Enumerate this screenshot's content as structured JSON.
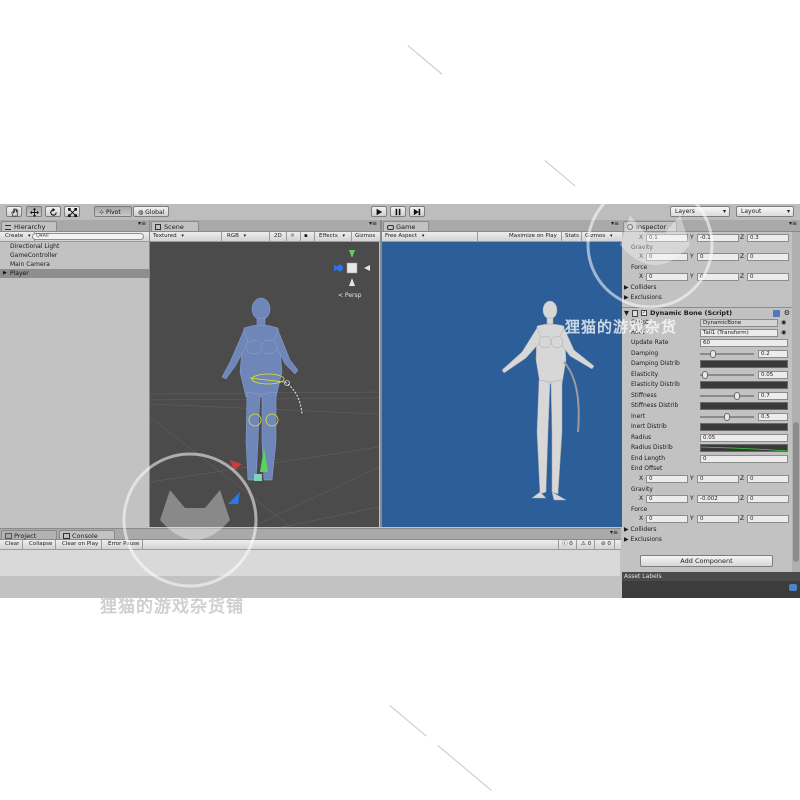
{
  "toolbar": {
    "pivot_label": "Pivot",
    "global_label": "Global",
    "layers_label": "Layers",
    "layout_label": "Layout"
  },
  "hierarchy": {
    "tab_label": "Hierarchy",
    "create_label": "Create",
    "search_placeholder": "Q▾All",
    "items": [
      {
        "label": "Directional Light"
      },
      {
        "label": "GameController"
      },
      {
        "label": "Main Camera"
      },
      {
        "label": "Player"
      }
    ]
  },
  "scene": {
    "tab_label": "Scene",
    "shading_mode": "Textured",
    "render_mode": "RGB",
    "mode_2d": "2D",
    "effects_label": "Effects",
    "gizmos_label": "Gizmos",
    "persp_label": "< Persp"
  },
  "game": {
    "tab_label": "Game",
    "aspect": "Free Aspect",
    "maximize_label": "Maximize on Play",
    "stats_label": "Stats",
    "gizmos_label": "Gizmos"
  },
  "bottom": {
    "project_tab": "Project",
    "console_tab": "Console",
    "clear_label": "Clear",
    "collapse_label": "Collapse",
    "clear_on_play_label": "Clear on Play",
    "error_pause_label": "Error Pause",
    "info_count": "0",
    "warn_count": "0",
    "error_count": "0"
  },
  "inspector": {
    "tab_label": "Inspector",
    "top": {
      "x": "0.1",
      "y": "-0.1",
      "z": "0.3",
      "gravity_label": "Gravity",
      "gravity": {
        "x": "0",
        "y": "0",
        "z": "0"
      },
      "force_label": "Force",
      "force": {
        "x": "0",
        "y": "0",
        "z": "0"
      },
      "colliders_label": "Colliders",
      "exclusions_label": "Exclusions"
    },
    "component_title": "Dynamic Bone (Script)",
    "script_label": "Script",
    "script_value": "DynamicBone",
    "root_label": "Root",
    "root_value": "Tail1 (Transform)",
    "update_rate_label": "Update Rate",
    "update_rate": "60",
    "damping_label": "Damping",
    "damping": "0.2",
    "damping_fraction": 0.2,
    "damping_distrib_label": "Damping Distrib",
    "elasticity_label": "Elasticity",
    "elasticity": "0.05",
    "elasticity_fraction": 0.05,
    "elasticity_distrib_label": "Elasticity Distrib",
    "stiffness_label": "Stiffness",
    "stiffness": "0.7",
    "stiffness_fraction": 0.7,
    "stiffness_distrib_label": "Stiffness Distrib",
    "inert_label": "Inert",
    "inert": "0.5",
    "inert_fraction": 0.5,
    "inert_distrib_label": "Inert Distrib",
    "radius_label": "Radius",
    "radius": "0.05",
    "radius_distrib_label": "Radius Distrib",
    "end_length_label": "End Length",
    "end_length": "0",
    "end_offset_label": "End Offset",
    "end_offset": {
      "x": "0",
      "y": "0",
      "z": "0"
    },
    "gravity_label": "Gravity",
    "gravity": {
      "x": "0",
      "y": "-0.002",
      "z": "0"
    },
    "force_label": "Force",
    "force": {
      "x": "0",
      "y": "0",
      "z": "0"
    },
    "colliders_label": "Colliders",
    "exclusions_label": "Exclusions",
    "add_component_label": "Add Component",
    "asset_labels": "Asset Labels"
  },
  "watermark": {
    "text": "狸猫的游戏杂货铺"
  },
  "colors": {
    "scene_bg": "#4b4b4b",
    "game_bg": "#2c5f9a",
    "panel_bg": "#c2c2c2",
    "model_scene": "#6f86b8",
    "model_game": "#d8d8d8"
  }
}
